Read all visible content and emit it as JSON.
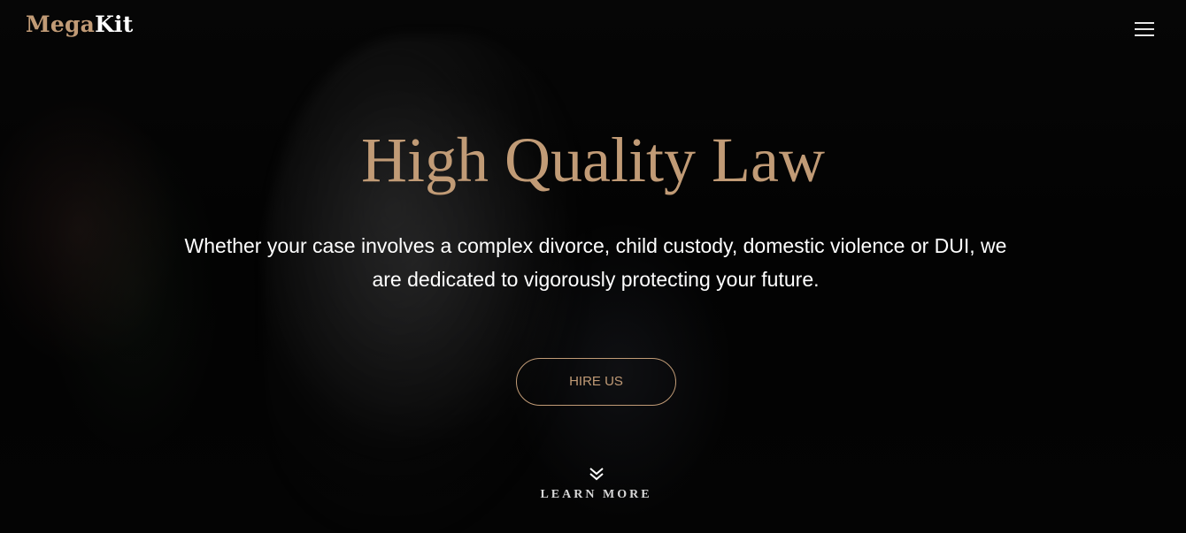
{
  "brand": {
    "logo_part1": "Mega",
    "logo_part2": "Kit",
    "accent_color": "#c19b76"
  },
  "nav": {
    "menu_icon": "hamburger-menu-icon"
  },
  "hero": {
    "title": "High Quality Law",
    "subtitle": "Whether your case involves a complex divorce, child custody, domestic violence or DUI, we are dedicated to vigorously protecting your future.",
    "cta_label": "HIRE US",
    "scroll_icon": "double-chevron-down-icon",
    "scroll_label": "LEARN MORE"
  }
}
